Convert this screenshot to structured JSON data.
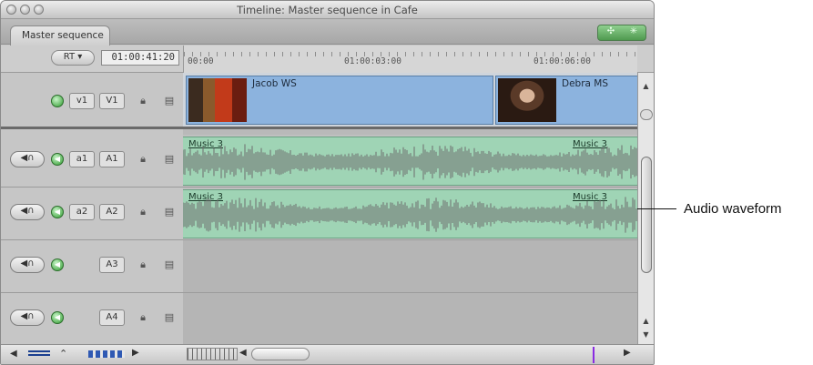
{
  "window": {
    "title": "Timeline: Master sequence in Cafe",
    "tab_label": "Master sequence"
  },
  "controls": {
    "rt_label": "RT ▾",
    "timecode": "01:00:41:20"
  },
  "ruler": {
    "labels": [
      "00:00",
      "01:00:03:00",
      "01:00:06:00"
    ]
  },
  "video_track": {
    "patch_label": "v1",
    "track_label": "V1",
    "clips": [
      {
        "name": "Jacob WS"
      },
      {
        "name": "Debra MS"
      }
    ]
  },
  "audio_tracks": [
    {
      "patch_label": "a1",
      "track_label": "A1",
      "clips": [
        "Music 3",
        "Music 3"
      ]
    },
    {
      "patch_label": "a2",
      "track_label": "A2",
      "clips": [
        "Music 3",
        "Music 3"
      ]
    },
    {
      "patch_label": "",
      "track_label": "A3",
      "clips": []
    },
    {
      "patch_label": "",
      "track_label": "A4",
      "clips": []
    }
  ],
  "callout": {
    "label": "Audio waveform"
  },
  "colors": {
    "video_clip": "#8cb3de",
    "audio_clip": "#9fd4b5",
    "waveform": "#6d6d6d",
    "track_enable_green": "#2f9a2f"
  },
  "icons": {
    "lock": "lock-icon",
    "film": "film-strip-icon",
    "speaker": "speaker-icon",
    "headphones": "headphones-icon"
  }
}
